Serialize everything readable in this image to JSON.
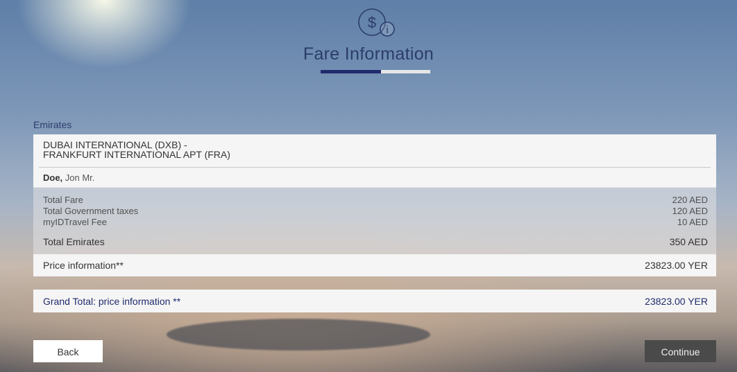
{
  "header": {
    "icon": "dollar-info-icon",
    "title": "Fare Information",
    "progress_fraction": 0.55
  },
  "airline": "Emirates",
  "route": {
    "line1": "DUBAI INTERNATIONAL (DXB) -",
    "line2": "FRANKFURT INTERNATIONAL APT (FRA)"
  },
  "passenger": {
    "last_name": "Doe,",
    "first_name": " Jon Mr."
  },
  "fares": [
    {
      "label": "Total Fare",
      "value": "220 AED"
    },
    {
      "label": "Total Government taxes",
      "value": "120 AED"
    },
    {
      "label": "myIDTravel Fee",
      "value": "10 AED"
    }
  ],
  "total": {
    "label": "Total Emirates",
    "value": "350 AED"
  },
  "price_info": {
    "label": "Price information**",
    "value": "23823.00 YER"
  },
  "grand_total": {
    "label": "Grand Total: price information **",
    "value": "23823.00 YER"
  },
  "buttons": {
    "back": "Back",
    "continue": "Continue"
  },
  "colors": {
    "accent": "#1f2a6b",
    "title": "#2b3d6b",
    "continue_bg": "#4a4a4a"
  }
}
